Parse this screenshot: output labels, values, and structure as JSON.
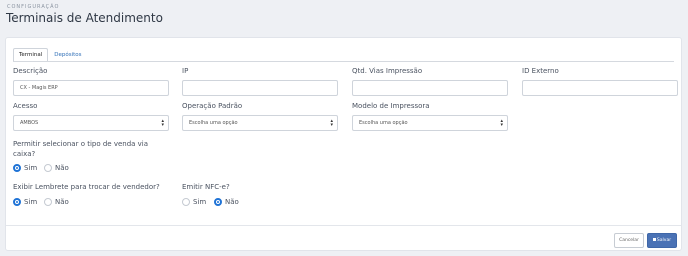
{
  "header": {
    "breadcrumb": "CONFIGURAÇÃO",
    "title": "Terminais de Atendimento"
  },
  "tabs": [
    {
      "label": "Terminal",
      "active": true
    },
    {
      "label": "Depósitos",
      "active": false
    }
  ],
  "fields": {
    "descricao": {
      "label": "Descrição",
      "value": "CX - Magis ERP"
    },
    "ip": {
      "label": "IP",
      "value": ""
    },
    "qtd_vias": {
      "label": "Qtd. Vias Impressão",
      "value": ""
    },
    "id_externo": {
      "label": "ID Externo",
      "value": ""
    },
    "acesso": {
      "label": "Acesso",
      "value": "AMBOS"
    },
    "operacao_padrao": {
      "label": "Operação Padrão",
      "value": "Escolha uma opção"
    },
    "modelo_impressora": {
      "label": "Modelo de Impressora",
      "value": "Escolha uma opção"
    }
  },
  "radios": {
    "tipo_venda": {
      "label_line1": "Permitir selecionar o tipo de venda via",
      "label_line2": "caixa?",
      "options": [
        "Sim",
        "Não"
      ],
      "selected": "Sim"
    },
    "lembrete_vendedor": {
      "label": "Exibir Lembrete para trocar de vendedor?",
      "options": [
        "Sim",
        "Não"
      ],
      "selected": "Sim"
    },
    "nfce": {
      "label": "Emitir NFC-e?",
      "options": [
        "Sim",
        "Não"
      ],
      "selected": "Não"
    }
  },
  "buttons": {
    "cancel": "Cancelar",
    "save": "Salvar",
    "save_icon": "save-icon"
  },
  "colors": {
    "accent": "#1f73d6",
    "save_button": "#4a72b5"
  }
}
